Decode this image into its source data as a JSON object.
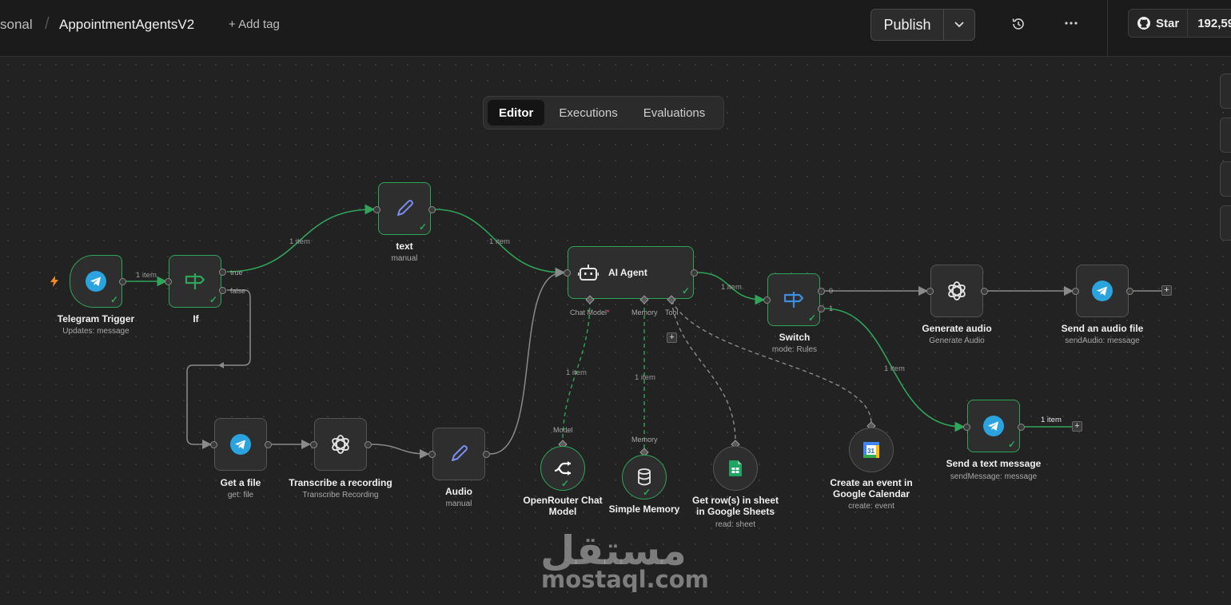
{
  "header": {
    "breadcrumb_prefix": "sonal",
    "separator": "/",
    "workflow_name": "AppointmentAgentsV2",
    "add_tag": "+ Add tag",
    "publish": "Publish",
    "github_star": "Star",
    "github_count": "192,59"
  },
  "tabs": [
    "Editor",
    "Executions",
    "Evaluations"
  ],
  "active_tab": "Editor",
  "nodes": {
    "telegram_trigger": {
      "title": "Telegram Trigger",
      "subtitle": "Updates: message",
      "icon": "telegram-icon"
    },
    "if": {
      "title": "If",
      "icon": "signpost-icon",
      "out_true": "true",
      "out_false": "false"
    },
    "text": {
      "title": "text",
      "subtitle": "manual",
      "icon": "pencil-icon"
    },
    "ai_agent": {
      "title": "AI Agent",
      "icon": "robot-icon",
      "chat_model": "Chat Model",
      "required_mark": "*",
      "memory": "Memory",
      "tool": "Tool"
    },
    "switch": {
      "title": "Switch",
      "subtitle": "mode: Rules",
      "icon": "signpost-icon",
      "out0": "0",
      "out1": "1"
    },
    "generate_audio": {
      "title": "Generate audio",
      "subtitle": "Generate Audio",
      "icon": "openai-icon"
    },
    "send_audio": {
      "title": "Send an audio file",
      "subtitle": "sendAudio: message",
      "icon": "telegram-icon"
    },
    "send_text": {
      "title": "Send a text message",
      "subtitle": "sendMessage: message",
      "icon": "telegram-icon"
    },
    "get_file": {
      "title": "Get a file",
      "subtitle": "get: file",
      "icon": "telegram-icon"
    },
    "transcribe": {
      "title": "Transcribe a recording",
      "subtitle": "Transcribe Recording",
      "icon": "openai-icon"
    },
    "audio": {
      "title": "Audio",
      "subtitle": "manual",
      "icon": "pencil-icon"
    },
    "openrouter": {
      "title_line1": "OpenRouter Chat",
      "title_line2": "Model",
      "port_label": "Model",
      "icon": "openrouter-icon"
    },
    "simple_memory": {
      "title": "Simple Memory",
      "port_label": "Memory",
      "icon": "database-icon"
    },
    "sheets": {
      "title_line1": "Get row(s) in sheet",
      "title_line2": "in Google Sheets",
      "subtitle": "read: sheet",
      "icon": "google-sheets-icon"
    },
    "calendar": {
      "title_line1": "Create an event in",
      "title_line2": "Google Calendar",
      "subtitle": "create: event",
      "icon": "google-calendar-icon"
    }
  },
  "edge_labels": {
    "item": "1 item"
  },
  "colors": {
    "success": "#2fa55a",
    "telegram": "#2aa3df",
    "canvas": "#222222"
  },
  "watermark": {
    "arabic": "مستقل",
    "latin": "mostaql.com"
  }
}
